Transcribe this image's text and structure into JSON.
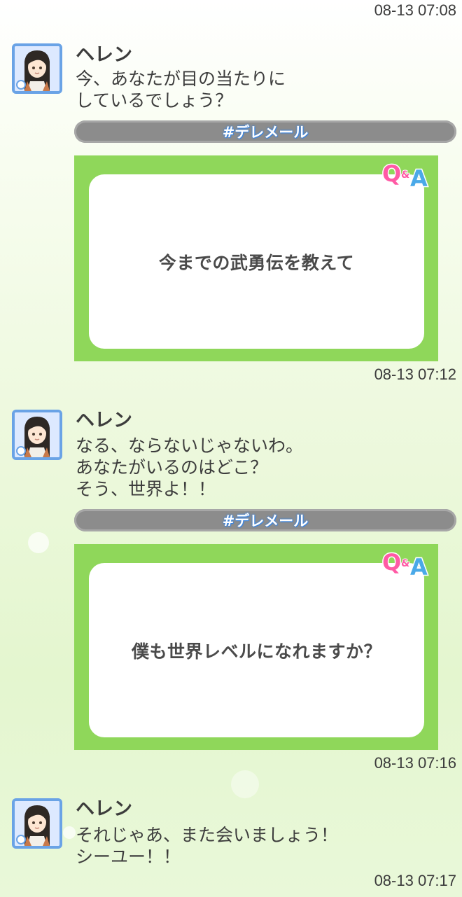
{
  "messages": [
    {
      "timestamp_before": "08-13 07:08",
      "sender": "ヘレン",
      "text": "今、あなたが目の当たりに\nしているでしょう？",
      "tag": "#デレメール",
      "qa_question": "今までの武勇伝を教えて",
      "qa_logo": "Q&A",
      "timestamp_after": "08-13 07:12"
    },
    {
      "sender": "ヘレン",
      "text": "なる、ならないじゃないわ。\nあなたがいるのはどこ？\nそう、世界よ！！",
      "tag": "#デレメール",
      "qa_question": "僕も世界レベルになれますか？",
      "qa_logo": "Q&A",
      "timestamp_after": "08-13 07:16"
    },
    {
      "sender": "ヘレン",
      "text": "それじゃあ、また会いましょう！\nシーユー！！",
      "timestamp_after": "08-13 07:17"
    }
  ],
  "colors": {
    "avatar_border": "#6aa3e6",
    "tag_bar": "#8c8c8c",
    "tag_text_glow": "#3d86e0",
    "qa_card": "#8fd75a",
    "qa_logo_q": "#ff5aa5",
    "qa_logo_a": "#4aa9e8"
  },
  "icons": {
    "avatar": "character-portrait",
    "avatar_badge": "gem-icon",
    "qa": "qa-logo-icon"
  }
}
